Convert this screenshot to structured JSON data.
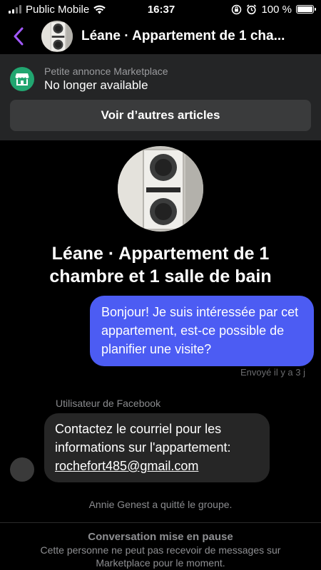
{
  "status_bar": {
    "carrier": "Public Mobile",
    "time": "16:37",
    "battery": "100 %",
    "battery_level": 1.0,
    "icons": [
      "signal-icon",
      "wifi-icon",
      "orientation-lock-icon",
      "alarm-icon",
      "battery-icon"
    ]
  },
  "header": {
    "title": "Léane · Appartement de 1 cha...",
    "back_icon": "chevron-left-icon"
  },
  "marketplace": {
    "label": "Petite annonce Marketplace",
    "status": "No longer available",
    "button_label": "Voir d’autres articles",
    "icon": "marketplace-store-icon"
  },
  "conversation": {
    "title": "Léane · Appartement de 1 chambre et 1 salle de bain"
  },
  "messages": {
    "outgoing": {
      "text": "Bonjour! Je suis intéressée par cet appartement, est-ce possible de planifier une visite?",
      "status": "Envoyé il y a 3 j"
    },
    "incoming": {
      "sender": "Utilisateur de Facebook",
      "text": "Contactez le courriel pour les informations sur l'appartement:",
      "email": "rochefort485@gmail.com"
    },
    "system": "Annie Genest a quitté le groupe."
  },
  "footer": {
    "title": "Conversation mise en pause",
    "text": "Cette personne ne peut pas recevoir de messages sur Marketplace pour le moment."
  },
  "colors": {
    "accent": "#a259ff",
    "outgoing_bubble": "#4c5cf3",
    "marketplace_green": "#21a670"
  }
}
